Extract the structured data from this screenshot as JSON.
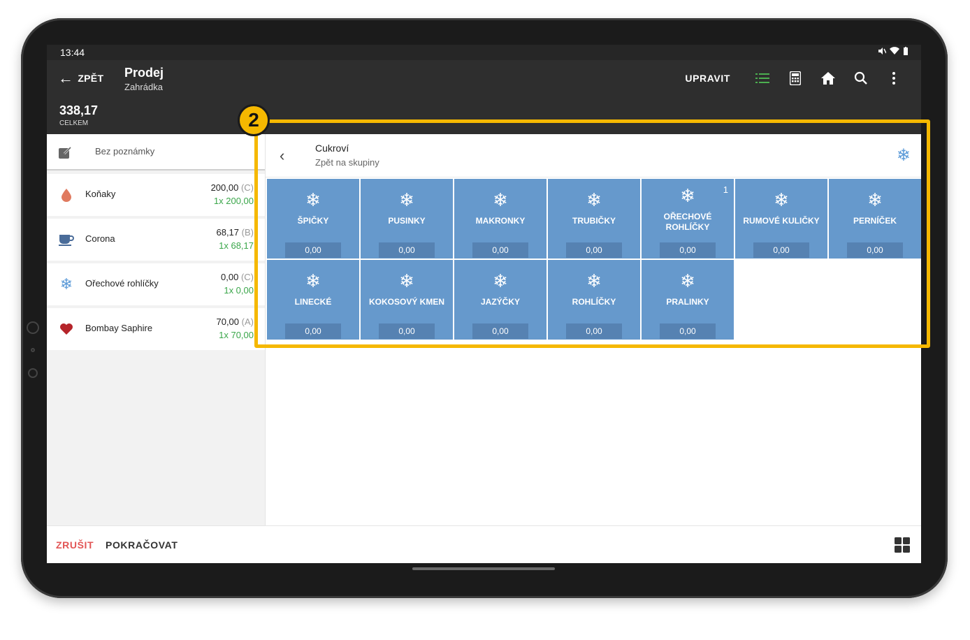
{
  "status_bar": {
    "time": "13:44",
    "icons": [
      "mute-icon",
      "wifi-icon",
      "battery-icon"
    ]
  },
  "app_bar": {
    "back_label": "ZPĚT",
    "title": "Prodej",
    "subtitle": "Zahrádka",
    "total_value": "338,17",
    "total_label": "CELKEM",
    "edit_label": "UPRAVIT",
    "accent_color": "#4caf50"
  },
  "order": {
    "note_placeholder": "Bez poznámky",
    "items": [
      {
        "name": "Koňaky",
        "price": "200,00",
        "category": "(C)",
        "qty": "1x 200,00",
        "icon": "drop-icon",
        "icon_color": "#e07a5f"
      },
      {
        "name": "Corona",
        "price": "68,17",
        "category": "(B)",
        "qty": "1x 68,17",
        "icon": "mug-icon",
        "icon_color": "#4a6c99"
      },
      {
        "name": "Ořechové rohlíčky",
        "price": "0,00",
        "category": "(C)",
        "qty": "1x 0,00",
        "icon": "snowflake-icon",
        "icon_color": "#5b9ad8"
      },
      {
        "name": "Bombay Saphire",
        "price": "70,00",
        "category": "(A)",
        "qty": "1x 70,00",
        "icon": "heart-icon",
        "icon_color": "#b5242a"
      }
    ]
  },
  "group": {
    "title": "Cukroví",
    "back_text": "Zpět na skupiny",
    "icon": "snowflake-icon",
    "tile_color": "#6699cc",
    "tiles": [
      {
        "name": "ŠPIČKY",
        "price": "0,00"
      },
      {
        "name": "PUSINKY",
        "price": "0,00"
      },
      {
        "name": "MAKRONKY",
        "price": "0,00"
      },
      {
        "name": "TRUBIČKY",
        "price": "0,00"
      },
      {
        "name": "OŘECHOVÉ ROHLÍČKY",
        "price": "0,00",
        "badge": "1"
      },
      {
        "name": "RUMOVÉ KULIČKY",
        "price": "0,00"
      },
      {
        "name": "PERNÍČEK",
        "price": "0,00"
      },
      {
        "name": "LINECKÉ",
        "price": "0,00"
      },
      {
        "name": "KOKOSOVÝ KMEN",
        "price": "0,00"
      },
      {
        "name": "JAZÝČKY",
        "price": "0,00"
      },
      {
        "name": "ROHLÍČKY",
        "price": "0,00"
      },
      {
        "name": "PRALINKY",
        "price": "0,00"
      }
    ]
  },
  "bottom_bar": {
    "cancel_label": "ZRUŠIT",
    "continue_label": "POKRAČOVAT"
  },
  "callout": {
    "number": "2",
    "color": "#f5b800"
  }
}
